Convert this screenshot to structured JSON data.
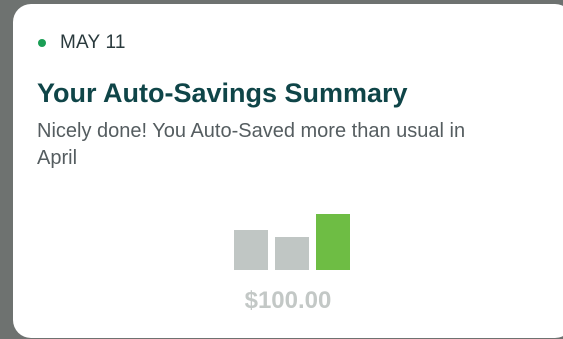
{
  "card": {
    "date": "MAY 11",
    "title": "Your Auto-Savings Summary",
    "subtitle": "Nicely done! You Auto-Saved more than usual in April",
    "amount": "$100.00",
    "dot_color": "#1a9e55"
  },
  "colors": {
    "past_bar": "#c0c6c4",
    "current_bar": "#6ebd44"
  },
  "bar_levels": [
    0.72,
    0.59,
    1.0
  ]
}
